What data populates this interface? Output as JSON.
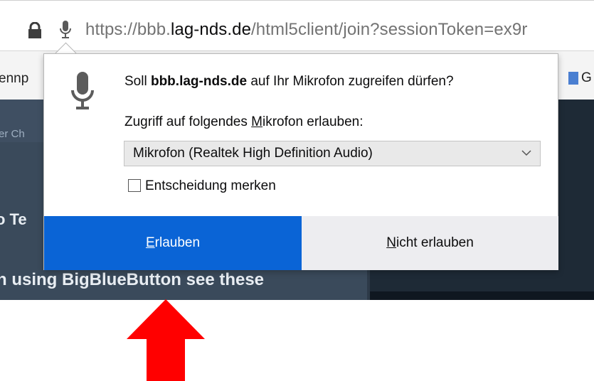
{
  "browser": {
    "url_prefix": "https://bbb.",
    "url_domain": "lag-nds.de",
    "url_suffix": "/html5client/join?sessionToken=ex9r"
  },
  "background": {
    "bookmark_left": "ennp",
    "bookmark_right": "G",
    "chat_label": "er Ch",
    "heading_fragment": "o Te",
    "body_line": "n using BigBlueButton see these"
  },
  "dialog": {
    "prompt_prefix": "Soll ",
    "prompt_domain": "bbb.lag-nds.de",
    "prompt_suffix": " auf Ihr Mikrofon zugreifen dürfen?",
    "select_label_prefix": "Zugriff auf folgendes ",
    "select_label_accesskey": "M",
    "select_label_suffix": "ikrofon erlauben:",
    "selected_device": "Mikrofon (Realtek High Definition Audio)",
    "remember_label": "Entscheidung merken",
    "remember_checked": false,
    "allow_accesskey": "E",
    "allow_rest": "rlauben",
    "deny_accesskey": "N",
    "deny_rest": "icht erlauben"
  },
  "colors": {
    "allow_button": "#0a64d6",
    "deny_button": "#ededf0",
    "annotation_arrow": "#ff0000"
  }
}
